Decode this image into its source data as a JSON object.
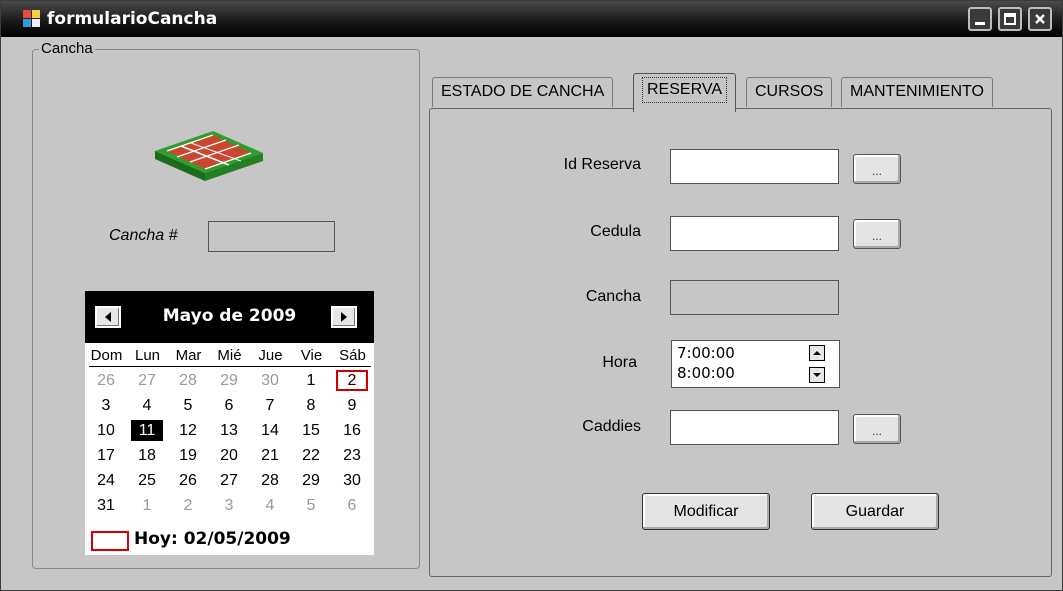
{
  "window": {
    "title": "formularioCancha",
    "buttons": [
      "minimize",
      "maximize",
      "close"
    ]
  },
  "group": {
    "legend": "Cancha",
    "court_icon": "tennis-court-icon",
    "cancha_label": "Cancha #",
    "cancha_value": ""
  },
  "calendar": {
    "month": "Mayo de 2009",
    "days_of_week": [
      "Dom",
      "Lun",
      "Mar",
      "Mié",
      "Jue",
      "Vie",
      "Sáb"
    ],
    "weeks": [
      [
        "26",
        "27",
        "28",
        "29",
        "30",
        "1",
        "2"
      ],
      [
        "3",
        "4",
        "5",
        "6",
        "7",
        "8",
        "9"
      ],
      [
        "10",
        "11",
        "12",
        "13",
        "14",
        "15",
        "16"
      ],
      [
        "17",
        "18",
        "19",
        "20",
        "21",
        "22",
        "23"
      ],
      [
        "24",
        "25",
        "26",
        "27",
        "28",
        "29",
        "30"
      ],
      [
        "31",
        "1",
        "2",
        "3",
        "4",
        "5",
        "6"
      ]
    ],
    "selected_day": "11",
    "today_day": "2",
    "today_label": "Hoy: 02/05/2009"
  },
  "tabs": [
    {
      "label": "ESTADO DE CANCHA"
    },
    {
      "label": "RESERVA"
    },
    {
      "label": "CURSOS"
    },
    {
      "label": "MANTENIMIENTO"
    }
  ],
  "active_tab": "RESERVA",
  "reserva": {
    "id_label": "Id Reserva",
    "id_value": "",
    "cedula_label": "Cedula",
    "cedula_value": "",
    "cancha_label": "Cancha",
    "cancha_value": "",
    "hora_label": "Hora",
    "hora_options": [
      "7:00:00",
      "8:00:00"
    ],
    "caddies_label": "Caddies",
    "caddies_value": "",
    "browse_label": "...",
    "modificar_label": "Modificar",
    "guardar_label": "Guardar"
  },
  "colors": {
    "titlebar": "#000000",
    "form_bg": "#c6c6c6",
    "today_outline": "#d40000"
  }
}
